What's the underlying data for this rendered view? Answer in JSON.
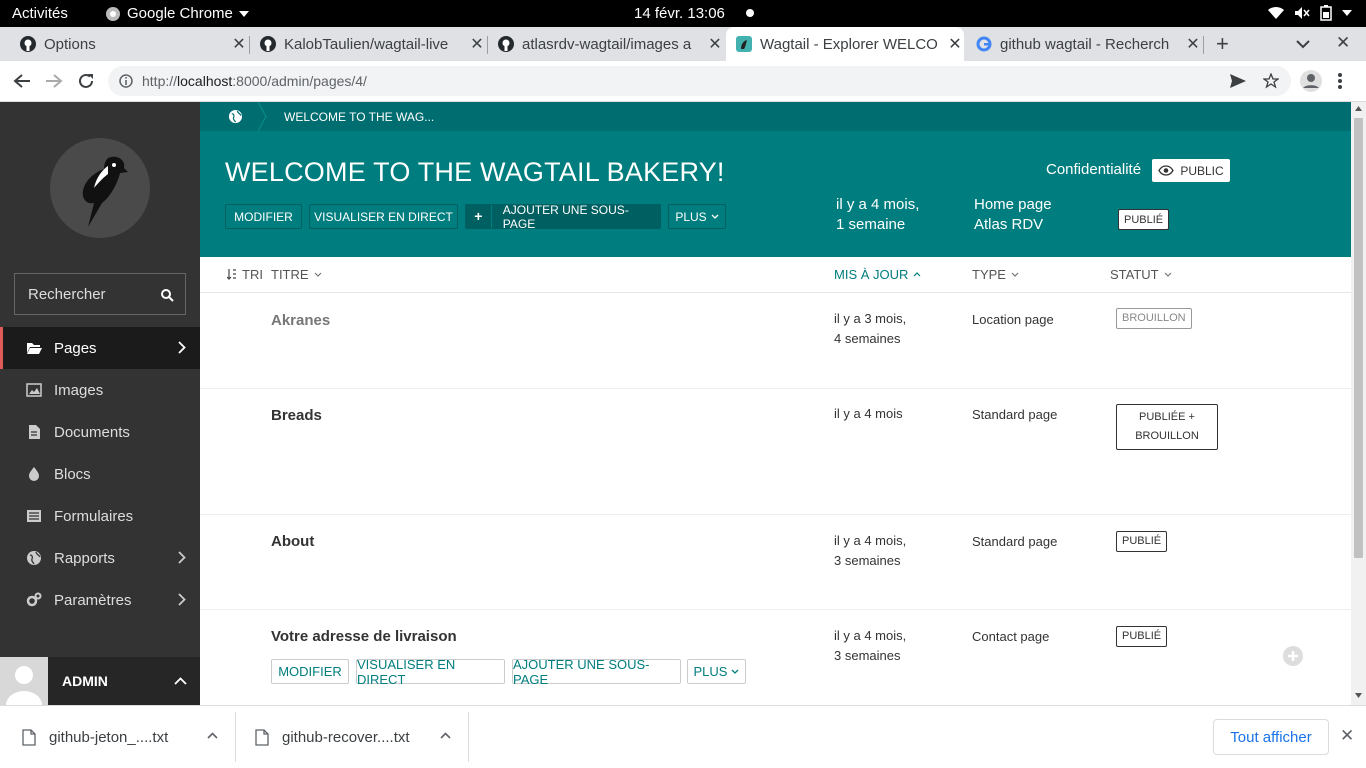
{
  "system_bar": {
    "activities": "Activités",
    "app": "Google Chrome",
    "clock": "14 févr.  13:06"
  },
  "browser": {
    "tabs": [
      {
        "title": "Options",
        "icon": "github-icon"
      },
      {
        "title": "KalobTaulien/wagtail-live",
        "icon": "github-icon"
      },
      {
        "title": "atlasrdv-wagtail/images a",
        "icon": "github-icon"
      },
      {
        "title": "Wagtail - Explorer WELCO",
        "icon": "wagtail-icon",
        "active": true
      },
      {
        "title": "github wagtail - Recherch",
        "icon": "google-icon"
      }
    ],
    "url_prefix": "http://",
    "url_host": "localhost",
    "url_rest": ":8000/admin/pages/4/"
  },
  "sidebar": {
    "search_placeholder": "Rechercher",
    "items": [
      {
        "label": "Pages",
        "icon": "folder-open-icon",
        "arrow": true,
        "active": true
      },
      {
        "label": "Images",
        "icon": "image-icon"
      },
      {
        "label": "Documents",
        "icon": "doc-icon"
      },
      {
        "label": "Blocs",
        "icon": "snippet-icon"
      },
      {
        "label": "Formulaires",
        "icon": "form-icon"
      },
      {
        "label": "Rapports",
        "icon": "globe-icon",
        "arrow": true
      },
      {
        "label": "Paramètres",
        "icon": "cogs-icon",
        "arrow": true
      }
    ],
    "user": "ADMIN"
  },
  "header": {
    "breadcrumb": "WELCOME TO THE WAG...",
    "title": "WELCOME TO THE WAGTAIL BAKERY!",
    "buttons": {
      "edit": "MODIFIER",
      "view_live": "VISUALISER EN DIRECT",
      "add_child": "AJOUTER UNE SOUS-PAGE",
      "more": "PLUS"
    },
    "updated_line1": "il y a 4 mois,",
    "updated_line2": "1 semaine",
    "owner_line1": "Home page",
    "owner_line2": "Atlas RDV",
    "privacy_label": "Confidentialité",
    "privacy_value": "PUBLIC",
    "status": "PUBLIÉ"
  },
  "table": {
    "headers": {
      "sort": "TRI",
      "title": "TITRE",
      "updated": "MIS À JOUR",
      "type": "TYPE",
      "status": "STATUT"
    },
    "rows": [
      {
        "title": "Akranes",
        "updated1": "il y a 3 mois,",
        "updated2": "4 semaines",
        "type": "Location page",
        "status": "BROUILLON"
      },
      {
        "title": "Breads",
        "updated1": "il y a 4 mois",
        "updated2": "",
        "type": "Standard page",
        "status1": "PUBLIÉE +",
        "status2": "BROUILLON"
      },
      {
        "title": "About",
        "updated1": "il y a 4 mois,",
        "updated2": "3 semaines",
        "type": "Standard page",
        "status": "PUBLIÉ"
      },
      {
        "title": "Votre adresse de livraison",
        "updated1": "il y a 4 mois,",
        "updated2": "3 semaines",
        "type": "Contact page",
        "status": "PUBLIÉ",
        "buttons": {
          "edit": "MODIFIER",
          "view_live": "VISUALISER EN DIRECT",
          "add_child": "AJOUTER UNE SOUS-PAGE",
          "more": "PLUS"
        }
      }
    ]
  },
  "downloads": {
    "items": [
      "github-jeton_....txt",
      "github-recover....txt"
    ],
    "show_all": "Tout afficher"
  },
  "colors": {
    "teal": "#007d7e",
    "teal_dark": "#006d70",
    "sidebar": "#333333",
    "active_marker": "#e05a5a"
  }
}
